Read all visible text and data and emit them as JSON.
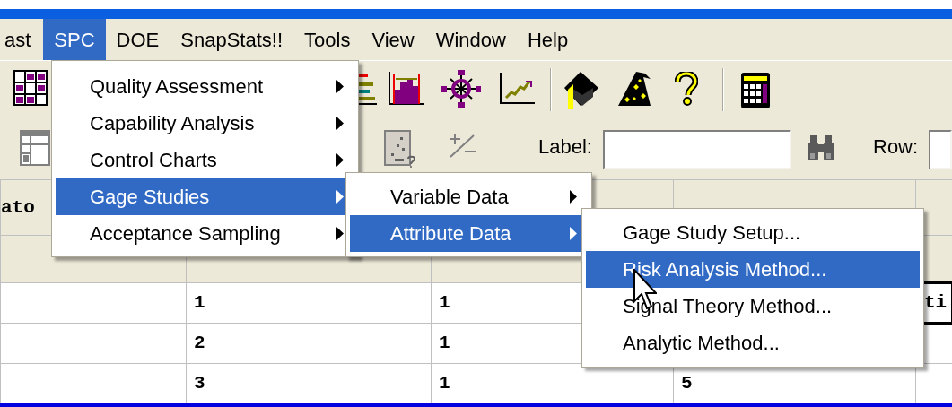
{
  "menubar": [
    {
      "label": "ast",
      "selected": false
    },
    {
      "label": "SPC",
      "selected": true
    },
    {
      "label": "DOE",
      "selected": false
    },
    {
      "label": "SnapStats!!",
      "selected": false
    },
    {
      "label": "Tools",
      "selected": false
    },
    {
      "label": "View",
      "selected": false
    },
    {
      "label": "Window",
      "selected": false
    },
    {
      "label": "Help",
      "selected": false
    }
  ],
  "toolbar_2": {
    "label_field_label": "Label:",
    "row_field_label": "Row:"
  },
  "grid": {
    "corner_header": "ato",
    "rows": [
      {
        "cells": [
          {
            "text": "",
            "selected": false
          },
          {
            "text": "1",
            "selected": false
          },
          {
            "text": "1",
            "selected": false
          },
          {},
          {
            "text": "ti",
            "selected": true
          }
        ]
      },
      {
        "cells": [
          {
            "text": "",
            "selected": false
          },
          {
            "text": "2",
            "selected": false
          },
          {
            "text": "1",
            "selected": false
          },
          {},
          {
            "text": "",
            "selected": false
          }
        ]
      },
      {
        "cells": [
          {
            "text": "",
            "selected": false
          },
          {
            "text": "3",
            "selected": false
          },
          {
            "text": "1",
            "selected": false
          },
          {
            "text": "5",
            "selected": false
          },
          {
            "text": "",
            "selected": false
          }
        ]
      }
    ]
  },
  "menus": [
    {
      "items": [
        {
          "label": "Quality Assessment",
          "has_submenu": true,
          "selected": false
        },
        {
          "label": "Capability Analysis",
          "has_submenu": true,
          "selected": false
        },
        {
          "label": "Control Charts",
          "has_submenu": true,
          "selected": false
        },
        {
          "label": "Gage Studies",
          "has_submenu": true,
          "selected": true
        },
        {
          "label": "Acceptance Sampling",
          "has_submenu": true,
          "selected": false
        }
      ]
    },
    {
      "items": [
        {
          "label": "Variable Data",
          "has_submenu": true,
          "selected": false
        },
        {
          "label": "Attribute Data",
          "has_submenu": true,
          "selected": true
        }
      ]
    },
    {
      "items": [
        {
          "label": "Gage Study Setup...",
          "has_submenu": false,
          "selected": false
        },
        {
          "label": "Risk Analysis Method...",
          "has_submenu": false,
          "selected": true
        },
        {
          "label": "Signal Theory Method...",
          "has_submenu": false,
          "selected": false
        },
        {
          "label": "Analytic Method...",
          "has_submenu": false,
          "selected": false
        }
      ]
    }
  ]
}
